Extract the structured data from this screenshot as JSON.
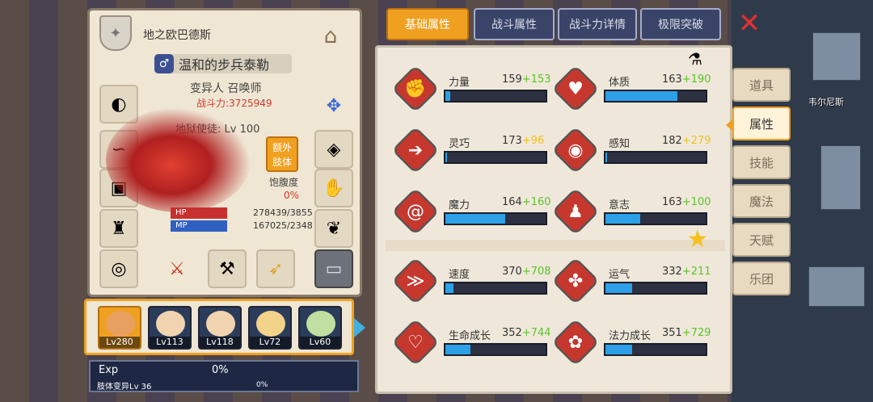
{
  "character": {
    "title": "地之欧巴德斯",
    "name": "温和的步兵泰勒",
    "class_line": "变异人 召唤师",
    "power_label": "战斗力:",
    "power_value": "3725949",
    "level_line": "地狱使徒: Lv 100",
    "extra_label_1": "额外",
    "extra_label_2": "肢体",
    "satiety_label": "饱腹度",
    "satiety_value": "0%",
    "hp_label": "HP",
    "hp_value": "278439/3855",
    "mp_label": "MP",
    "mp_value": "167025/2348"
  },
  "team": [
    {
      "level": "Lv280",
      "selected": true
    },
    {
      "level": "Lv113",
      "selected": false
    },
    {
      "level": "Lv118",
      "selected": false
    },
    {
      "level": "Lv72",
      "selected": false
    },
    {
      "level": "Lv60",
      "selected": false
    }
  ],
  "exp": {
    "label": "Exp",
    "value": "0%",
    "limb_label": "肢体变异Lv 36",
    "limb_value": "0%"
  },
  "tabs": [
    "基础属性",
    "战斗属性",
    "战斗力详情",
    "极限突破"
  ],
  "active_tab": 0,
  "stats": [
    {
      "name": "力量",
      "base": "159",
      "bonus": "+153",
      "bonus_color": "green",
      "fill": 0.05,
      "icon": "arm-icon"
    },
    {
      "name": "体质",
      "base": "163",
      "bonus": "+190",
      "bonus_color": "green",
      "fill": 0.72,
      "icon": "heart-body-icon"
    },
    {
      "name": "灵巧",
      "base": "173",
      "bonus": "+96",
      "bonus_color": "yellow",
      "fill": 0.02,
      "icon": "runner-icon"
    },
    {
      "name": "感知",
      "base": "182",
      "bonus": "+279",
      "bonus_color": "yellow",
      "fill": 0.02,
      "icon": "eye-icon"
    },
    {
      "name": "魔力",
      "base": "164",
      "bonus": "+160",
      "bonus_color": "green",
      "fill": 0.6,
      "icon": "spiral-icon"
    },
    {
      "name": "意志",
      "base": "163",
      "bonus": "+100",
      "bonus_color": "green",
      "fill": 0.35,
      "icon": "will-icon"
    },
    {
      "name": "速度",
      "base": "370",
      "bonus": "+708",
      "bonus_color": "green",
      "fill": 0.08,
      "icon": "speed-icon"
    },
    {
      "name": "运气",
      "base": "332",
      "bonus": "+211",
      "bonus_color": "green",
      "fill": 0.27,
      "icon": "clover-icon"
    },
    {
      "name": "生命成长",
      "base": "352",
      "bonus": "+744",
      "bonus_color": "green",
      "fill": 0.25,
      "icon": "life-growth-icon"
    },
    {
      "name": "法力成长",
      "base": "351",
      "bonus": "+729",
      "bonus_color": "green",
      "fill": 0.27,
      "icon": "mana-growth-icon"
    }
  ],
  "side_menu": [
    "道具",
    "属性",
    "技能",
    "魔法",
    "天赋",
    "乐团"
  ],
  "active_side": 1,
  "town_label": "韦尔尼斯",
  "colors": {
    "accent": "#f0a020",
    "bar_fill": "#2da0e8",
    "bonus_green": "#5cc22a",
    "bonus_yellow": "#f0c020",
    "power_red": "#d23a2f"
  }
}
